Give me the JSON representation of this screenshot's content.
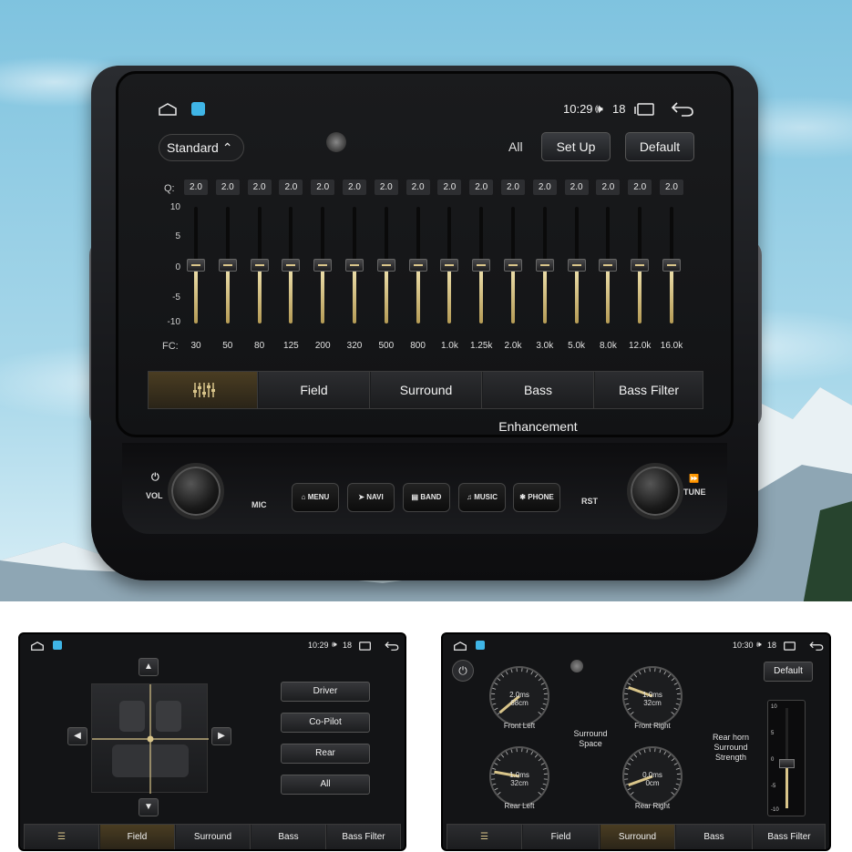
{
  "status": {
    "time": "10:29",
    "volume": "18"
  },
  "preset": {
    "label": "Standard"
  },
  "toolbar": {
    "all_label": "All",
    "setup_label": "Set Up",
    "default_label": "Default"
  },
  "eq": {
    "q_label": "Q:",
    "fc_label": "FC:",
    "scale": [
      "10",
      "5",
      "0",
      "-5",
      "-10"
    ],
    "bands": [
      {
        "q": "2.0",
        "fc": "30",
        "gain": 0
      },
      {
        "q": "2.0",
        "fc": "50",
        "gain": 0
      },
      {
        "q": "2.0",
        "fc": "80",
        "gain": 0
      },
      {
        "q": "2.0",
        "fc": "125",
        "gain": 0
      },
      {
        "q": "2.0",
        "fc": "200",
        "gain": 0
      },
      {
        "q": "2.0",
        "fc": "320",
        "gain": 0
      },
      {
        "q": "2.0",
        "fc": "500",
        "gain": 0
      },
      {
        "q": "2.0",
        "fc": "800",
        "gain": 0
      },
      {
        "q": "2.0",
        "fc": "1.0k",
        "gain": 0
      },
      {
        "q": "2.0",
        "fc": "1.25k",
        "gain": 0
      },
      {
        "q": "2.0",
        "fc": "2.0k",
        "gain": 0
      },
      {
        "q": "2.0",
        "fc": "3.0k",
        "gain": 0
      },
      {
        "q": "2.0",
        "fc": "5.0k",
        "gain": 0
      },
      {
        "q": "2.0",
        "fc": "8.0k",
        "gain": 0
      },
      {
        "q": "2.0",
        "fc": "12.0k",
        "gain": 0
      },
      {
        "q": "2.0",
        "fc": "16.0k",
        "gain": 0
      }
    ]
  },
  "tabs": {
    "field": "Field",
    "surround": "Surround",
    "bass_enhancement": "Bass Enhancement",
    "bass_filter": "Bass Filter"
  },
  "hardware": {
    "vol": "VOL",
    "mic": "MIC",
    "rst": "RST",
    "tune": "TUNE",
    "menu": "MENU",
    "navi": "NAVI",
    "band": "BAND",
    "music": "MUSIC",
    "phone": "PHONE"
  },
  "field_panel": {
    "time": "10:29",
    "volume": "18",
    "positions": [
      "Driver",
      "Co-Pilot",
      "Rear",
      "All"
    ]
  },
  "surround_panel": {
    "time": "10:30",
    "volume": "18",
    "default_label": "Default",
    "surround_space": [
      "Surround",
      "Space"
    ],
    "rear_horn": [
      "Rear horn",
      "Surround",
      "Strength"
    ],
    "dials": [
      {
        "label": "Front Left",
        "top": "2.0ms",
        "bottom": "68cm"
      },
      {
        "label": "Front Right",
        "top": "1.0ms",
        "bottom": "32cm"
      },
      {
        "label": "Rear Left",
        "top": "1.0ms",
        "bottom": "32cm"
      },
      {
        "label": "Rear Right",
        "top": "0.0ms",
        "bottom": "0cm"
      }
    ],
    "slider_scale": [
      "10",
      "5",
      "0",
      "-5",
      "-10"
    ]
  }
}
